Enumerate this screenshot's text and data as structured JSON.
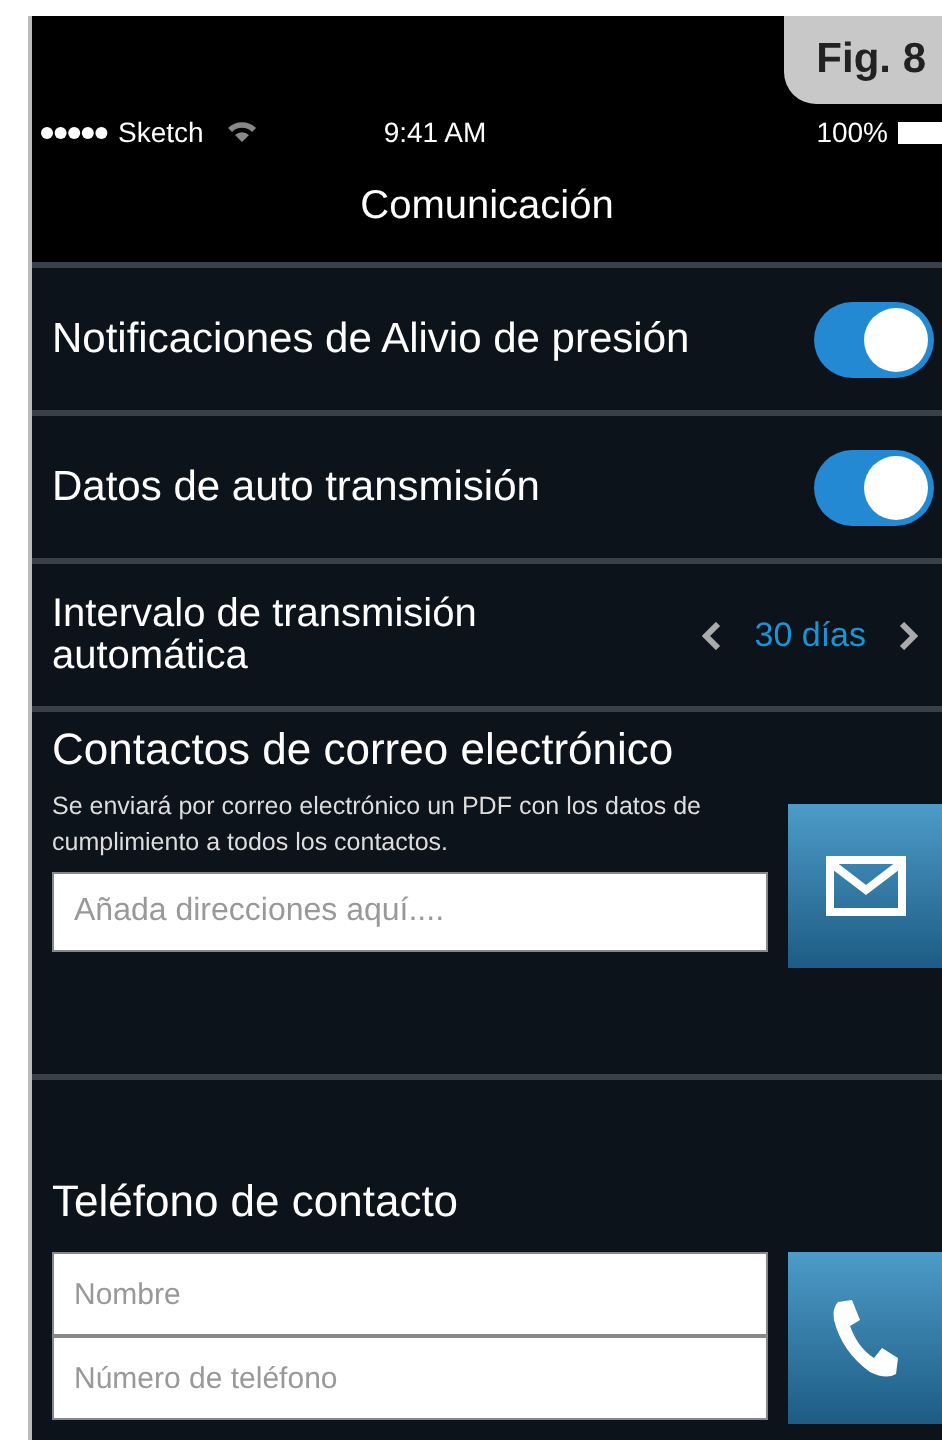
{
  "figure_label": "Fig. 8",
  "status_bar": {
    "carrier": "Sketch",
    "time": "9:41 AM",
    "battery": "100%"
  },
  "title": "Comunicación",
  "settings": [
    {
      "kind": "toggle",
      "label": "Notificaciones de Alivio de presión",
      "on": true
    },
    {
      "kind": "toggle",
      "label": "Datos de auto transmisión",
      "on": true
    },
    {
      "kind": "stepper",
      "label": "Intervalo de transmisión automática",
      "value": "30 días"
    }
  ],
  "email_section": {
    "title": "Contactos de correo electrónico",
    "description": "Se enviará por correo electrónico un PDF con los datos de cumplimiento a todos los contactos.",
    "field": {
      "placeholder": "Añada direcciones aquí...."
    }
  },
  "phone_section": {
    "title": "Teléfono de contacto",
    "fields": [
      {
        "placeholder": "Nombre"
      },
      {
        "placeholder": "Número de teléfono"
      }
    ]
  }
}
